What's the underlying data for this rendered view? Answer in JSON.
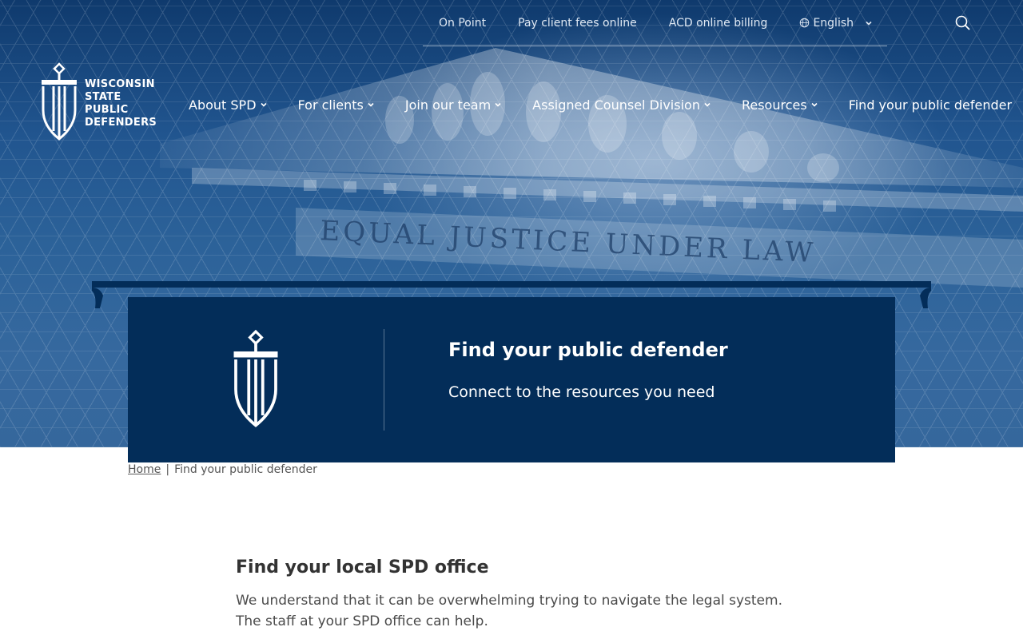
{
  "utility_nav": {
    "links": [
      "On Point",
      "Pay client fees online",
      "ACD online billing"
    ],
    "language": "English",
    "search_icon": "search-icon"
  },
  "logo": {
    "lines": [
      "WISCONSIN",
      "STATE",
      "PUBLIC",
      "DEFENDERS"
    ]
  },
  "main_nav": {
    "items": [
      {
        "label": "About SPD",
        "has_dropdown": true
      },
      {
        "label": "For clients",
        "has_dropdown": true
      },
      {
        "label": "Join our team",
        "has_dropdown": true
      },
      {
        "label": "Assigned Counsel Division",
        "has_dropdown": true
      },
      {
        "label": "Resources",
        "has_dropdown": true
      },
      {
        "label": "Find your public defender",
        "has_dropdown": false
      }
    ]
  },
  "hero": {
    "inscription": "EQUAL JUSTICE UNDER LAW"
  },
  "banner": {
    "title": "Find your public defender",
    "subtitle": "Connect to the resources you need"
  },
  "breadcrumb": {
    "home": "Home",
    "separator": "|",
    "current": "Find your public defender"
  },
  "content": {
    "heading": "Find your local SPD office",
    "paragraph_line1": "We understand that it can be overwhelming trying to navigate the legal system.",
    "paragraph_line2": "The staff at your SPD office can help."
  },
  "colors": {
    "banner_bg": "#032d59",
    "hero_top": "#0f3a6d",
    "hero_bottom": "#35679c",
    "text_dark": "#333333"
  }
}
